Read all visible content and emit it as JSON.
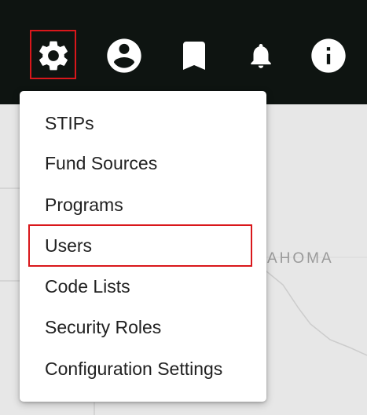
{
  "toolbar": {
    "icons": [
      {
        "name": "settings",
        "icon": "gear-icon",
        "highlighted": true
      },
      {
        "name": "account",
        "icon": "account-circle-icon"
      },
      {
        "name": "bookmarks",
        "icon": "bookmark-icon"
      },
      {
        "name": "notifications",
        "icon": "bell-icon"
      },
      {
        "name": "info",
        "icon": "info-icon"
      }
    ],
    "background": "#0e1411",
    "icon_color": "#ffffff"
  },
  "settings_menu": {
    "items": [
      {
        "label": "STIPs"
      },
      {
        "label": "Fund Sources"
      },
      {
        "label": "Programs"
      },
      {
        "label": "Users",
        "highlighted": true
      },
      {
        "label": "Code Lists"
      },
      {
        "label": "Security Roles"
      },
      {
        "label": "Configuration Settings"
      }
    ]
  },
  "map": {
    "label": "AHOMA"
  },
  "colors": {
    "highlight": "#d9171b",
    "menu_background": "#ffffff",
    "map_background": "#e7e7e7"
  }
}
